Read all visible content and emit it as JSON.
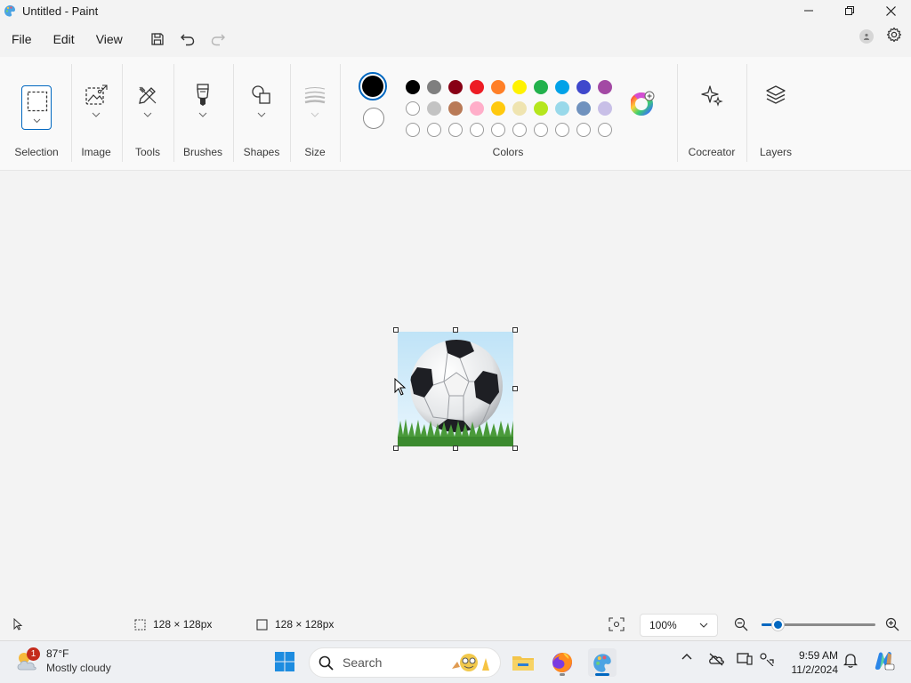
{
  "window": {
    "title": "Untitled - Paint"
  },
  "menu": {
    "items": [
      "File",
      "Edit",
      "View"
    ]
  },
  "ribbon": {
    "groups": {
      "selection": "Selection",
      "image": "Image",
      "tools": "Tools",
      "brushes": "Brushes",
      "shapes": "Shapes",
      "size": "Size",
      "colors": "Colors",
      "cocreator": "Cocreator",
      "layers": "Layers"
    },
    "primary_color": "#000000",
    "secondary_color": "#ffffff",
    "palette_row1": [
      "#000000",
      "#7f7f7f",
      "#880015",
      "#ed1c24",
      "#ff7f27",
      "#fff200",
      "#22b14c",
      "#00a2e8",
      "#3f48cc",
      "#a349a4"
    ],
    "palette_row2": [
      "#ffffff",
      "#c3c3c3",
      "#b97a57",
      "#ffaec9",
      "#ffc90e",
      "#efe4b0",
      "#b5e61d",
      "#99d9ea",
      "#7092be",
      "#c8bfe7"
    ],
    "palette_row3_count": 10
  },
  "status": {
    "selection_size": "128 × 128px",
    "canvas_size": "128 × 128px",
    "zoom": "100%",
    "zoom_level": 0.14
  },
  "taskbar": {
    "weather_temp": "87°F",
    "weather_desc": "Mostly cloudy",
    "weather_badge": "1",
    "search_placeholder": "Search",
    "time": "9:59 AM",
    "date": "11/2/2024"
  }
}
